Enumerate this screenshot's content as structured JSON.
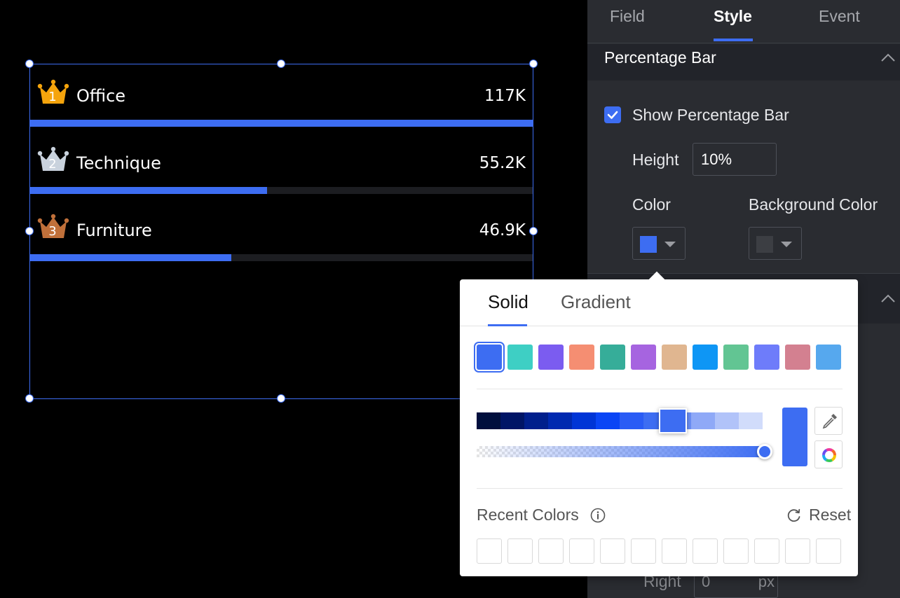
{
  "ranking": {
    "max_value": 117,
    "items": [
      {
        "rank": "1",
        "name": "Office",
        "value": "117K",
        "numeric": 117,
        "crown_color": "#f5a40c"
      },
      {
        "rank": "2",
        "name": "Technique",
        "value": "55.2K",
        "numeric": 55.2,
        "crown_color": "#c9d2dd"
      },
      {
        "rank": "3",
        "name": "Furniture",
        "value": "46.9K",
        "numeric": 46.9,
        "crown_color": "#c0703a"
      }
    ]
  },
  "panel": {
    "tabs": [
      "Field",
      "Style",
      "Event"
    ],
    "active_tab": "Style",
    "section_title": "Percentage Bar",
    "show_bar_label": "Show Percentage Bar",
    "show_bar_checked": true,
    "height_label": "Height",
    "height_value": "10%",
    "color_label": "Color",
    "bg_color_label": "Background Color",
    "color_value": "#3d6df2",
    "bg_color_value": "#3c3e43",
    "right_label": "Right",
    "right_value": "0",
    "right_unit": "px"
  },
  "picker": {
    "tabs": {
      "solid": "Solid",
      "gradient": "Gradient"
    },
    "active_tab": "Solid",
    "presets": [
      "#3d6df2",
      "#3ecfc4",
      "#7b5cf0",
      "#f58e72",
      "#36ad99",
      "#a664e0",
      "#e0b690",
      "#0e96f5",
      "#62c593",
      "#6e7cfa",
      "#d38090",
      "#56a8ee"
    ],
    "selected_preset": "#3d6df2",
    "shades": [
      "#000f3d",
      "#001566",
      "#001f8c",
      "#0029b0",
      "#0035d6",
      "#0a45f5",
      "#2a5cf5",
      "#3d6df2",
      "#6a8ef5",
      "#8fa9f7",
      "#b1c3f9",
      "#d1dcfb"
    ],
    "current_color": "#3d6df2",
    "opacity": 1,
    "recent_label": "Recent Colors",
    "reset_label": "Reset",
    "recent_colors": [
      "",
      "",
      "",
      "",
      "",
      "",
      "",
      "",
      "",
      "",
      "",
      ""
    ]
  }
}
